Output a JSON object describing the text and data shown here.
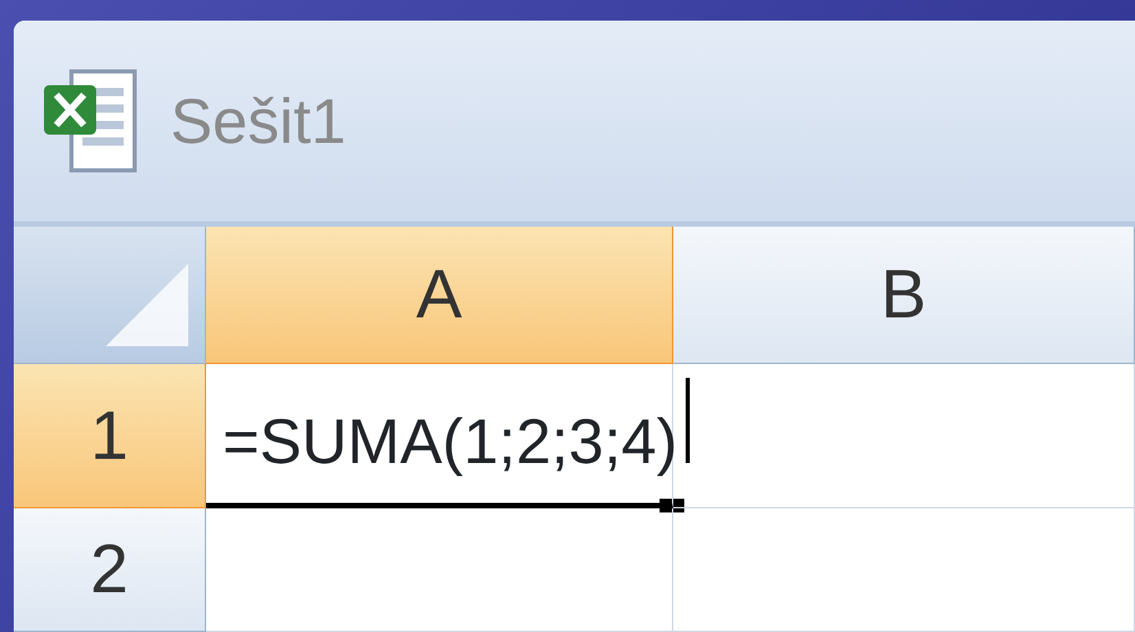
{
  "window": {
    "title": "Sešit1"
  },
  "columns": [
    {
      "label": "A",
      "selected": true
    },
    {
      "label": "B",
      "selected": false
    }
  ],
  "rows": [
    {
      "header": "1",
      "selected": true,
      "cells": [
        {
          "text": "=SUMA(1;2;3;4)",
          "editing": true
        }
      ]
    },
    {
      "header": "2",
      "selected": false,
      "cells": []
    }
  ]
}
